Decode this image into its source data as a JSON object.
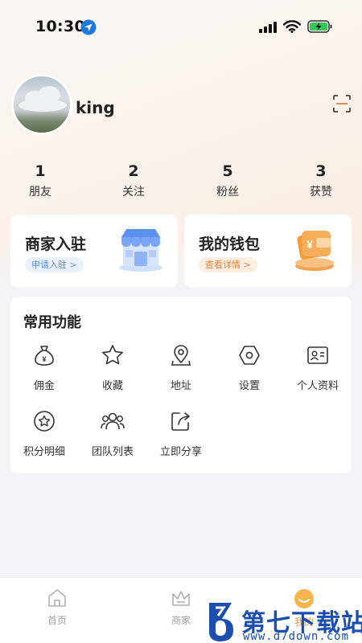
{
  "status_bar": {
    "time": "10:30"
  },
  "profile": {
    "username": "king"
  },
  "stats": [
    {
      "value": "1",
      "label": "朋友"
    },
    {
      "value": "2",
      "label": "关注"
    },
    {
      "value": "5",
      "label": "粉丝"
    },
    {
      "value": "3",
      "label": "获赞"
    }
  ],
  "merchant_card": {
    "title": "商家入驻",
    "action": "申请入驻 >"
  },
  "wallet_card": {
    "title": "我的钱包",
    "action": "查看详情 >"
  },
  "features": {
    "title": "常用功能",
    "items": [
      {
        "label": "佣金",
        "icon": "money-bag-icon"
      },
      {
        "label": "收藏",
        "icon": "star-icon"
      },
      {
        "label": "地址",
        "icon": "location-pin-icon"
      },
      {
        "label": "设置",
        "icon": "settings-hexagon-icon"
      },
      {
        "label": "个人资料",
        "icon": "id-card-icon"
      },
      {
        "label": "积分明细",
        "icon": "points-star-icon"
      },
      {
        "label": "团队列表",
        "icon": "team-icon"
      },
      {
        "label": "立即分享",
        "icon": "share-icon"
      }
    ]
  },
  "tabbar": {
    "tabs": [
      {
        "label": "首页",
        "icon": "home-icon"
      },
      {
        "label": "商家",
        "icon": "crown-icon"
      },
      {
        "label": "我的",
        "icon": "profile-smile-icon"
      }
    ],
    "active_color": "#f29a3c"
  },
  "watermark": {
    "name": "第七下载站",
    "url": "www.d7down.com"
  },
  "colors": {
    "accent_blue": "#5a8ddc",
    "accent_orange": "#e0823f",
    "card_bg": "#ffffff"
  }
}
